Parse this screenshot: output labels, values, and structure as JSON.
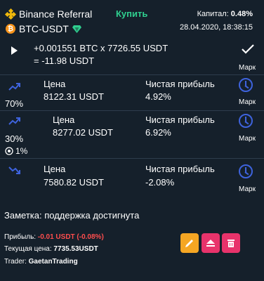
{
  "header": {
    "source": "Binance Referral",
    "pair": "BTC-USDT",
    "buy_label": "Купить",
    "capital_label": "Капитал:",
    "capital_value": "0.48%",
    "datetime": "28.04.2020, 18:38:15"
  },
  "entry": {
    "line1": "+0.001551 BTC x 7726.55 USDT",
    "line2": "= -11.98 USDT",
    "mark_label": "Марк"
  },
  "targets": [
    {
      "percent": "70%",
      "price_label": "Цена",
      "price": "8122.31 USDT",
      "profit_label": "Чистая прибыль",
      "profit": "4.92%",
      "mark_label": "Марк"
    },
    {
      "percent": "30%",
      "extra": "1%",
      "price_label": "Цена",
      "price": "8277.02 USDT",
      "profit_label": "Чистая прибыль",
      "profit": "6.92%",
      "mark_label": "Марк"
    },
    {
      "price_label": "Цена",
      "price": "7580.82 USDT",
      "profit_label": "Чистая прибыль",
      "profit": "-2.08%",
      "mark_label": "Марк"
    }
  ],
  "footer": {
    "note": "Заметка: поддержка достигнута",
    "profit_label": "Прибыль:",
    "profit_value": "-0.01 USDT (-0.08%)",
    "price_label": "Текущая цена:",
    "price_value": "7735.53USDT",
    "trader_label": "Trader:",
    "trader_value": "GaetanTrading"
  },
  "colors": {
    "background": "#15202b",
    "buy": "#2fcf8f",
    "accent_blue": "#3e63dd",
    "loss": "#ff4d4d",
    "edit_button": "#f5a623",
    "eject_button": "#e8336b",
    "delete_button": "#e8336b"
  },
  "icons": [
    "binance-icon",
    "btc-icon",
    "diamond-icon",
    "play-icon",
    "check-icon",
    "trend-up-icon",
    "trend-down-icon",
    "clock-icon",
    "target-icon",
    "pencil-icon",
    "eject-icon",
    "trash-icon"
  ]
}
